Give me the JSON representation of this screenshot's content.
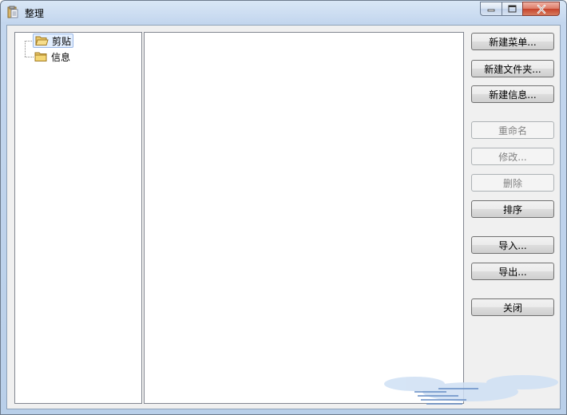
{
  "window": {
    "title": "整理",
    "icons": {
      "app": "clipboard-icon",
      "minimize": "minimize-icon",
      "maximize": "maximize-icon",
      "close": "close-icon"
    }
  },
  "tree": {
    "items": [
      {
        "label": "剪贴",
        "icon": "folder-open-icon",
        "selected": true
      },
      {
        "label": "信息",
        "icon": "folder-icon",
        "selected": false
      }
    ]
  },
  "buttons": {
    "new_menu": "新建菜单...",
    "new_folder": "新建文件夹...",
    "new_info": "新建信息...",
    "rename": "重命名",
    "modify": "修改...",
    "delete": "删除",
    "sort": "排序",
    "import": "导入...",
    "export": "导出...",
    "close": "关闭"
  },
  "colors": {
    "titlebar": "#c3d6ee",
    "client_bg": "#f0f0f0",
    "close_button": "#c6432b",
    "selection": "#e3efff"
  }
}
